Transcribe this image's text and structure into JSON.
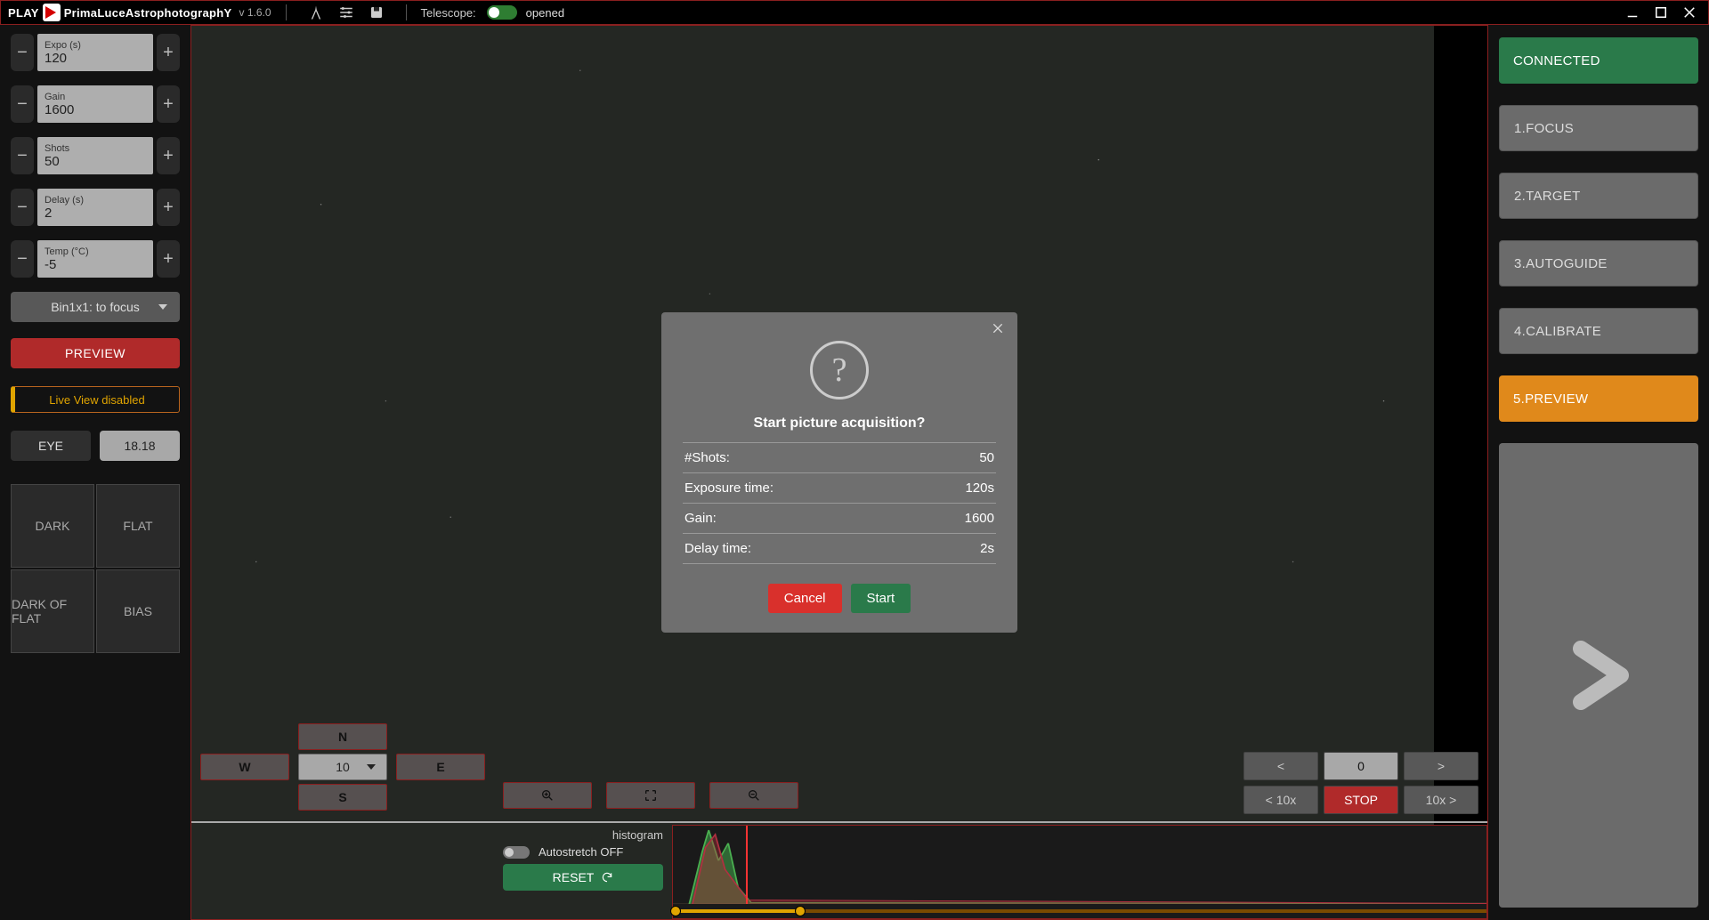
{
  "header": {
    "app_prefix": "PLAY",
    "app_name": "PrimaLuceAstrophotographY",
    "version": "v 1.6.0",
    "telescope_label": "Telescope:",
    "telescope_status": "opened"
  },
  "left": {
    "fields": [
      {
        "label": "Expo (s)",
        "value": "120"
      },
      {
        "label": "Gain",
        "value": "1600"
      },
      {
        "label": "Shots",
        "value": "50"
      },
      {
        "label": "Delay (s)",
        "value": "2"
      },
      {
        "label": "Temp (°C)",
        "value": "-5"
      }
    ],
    "binning": "Bin1x1: to focus",
    "preview_button": "PREVIEW",
    "liveview": "Live View disabled",
    "eye_label": "EYE",
    "eye_value": "18.18",
    "cal": {
      "dark": "DARK",
      "flat": "FLAT",
      "darkflat": "DARK OF FLAT",
      "bias": "BIAS"
    }
  },
  "dirpad": {
    "n": "N",
    "s": "S",
    "e": "E",
    "w": "W",
    "speed": "10"
  },
  "nav": {
    "prev": "<",
    "cur": "0",
    "next": ">",
    "prev10": "< 10x",
    "stop": "STOP",
    "next10": "10x >"
  },
  "histo": {
    "title": "histogram",
    "autostretch": "Autostretch OFF",
    "reset": "RESET"
  },
  "right": {
    "connected": "CONNECTED",
    "steps": [
      "1.FOCUS",
      "2.TARGET",
      "3.AUTOGUIDE",
      "4.CALIBRATE",
      "5.PREVIEW"
    ],
    "active_index": 4
  },
  "modal": {
    "title": "Start picture acquisition?",
    "rows": [
      {
        "k": "#Shots:",
        "v": "50"
      },
      {
        "k": "Exposure time:",
        "v": "120s"
      },
      {
        "k": "Gain:",
        "v": "1600"
      },
      {
        "k": "Delay time:",
        "v": "2s"
      }
    ],
    "cancel": "Cancel",
    "start": "Start"
  }
}
